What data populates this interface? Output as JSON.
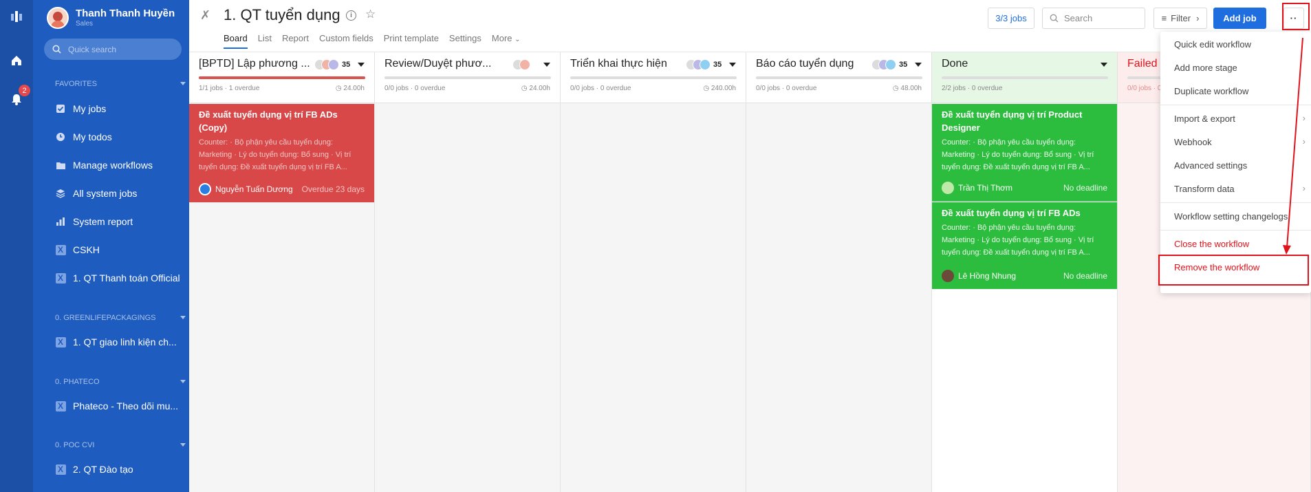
{
  "user": {
    "name": "Thanh Thanh Huyền",
    "role": "Sales"
  },
  "rail": {
    "notification_count": "2"
  },
  "sidebar": {
    "quick_search_placeholder": "Quick search",
    "favorites_title": "FAVORITES",
    "favorites": [
      {
        "label": "My jobs",
        "icon": "checkbox-icon"
      },
      {
        "label": "My todos",
        "icon": "clock-icon"
      },
      {
        "label": "Manage workflows",
        "icon": "folder-icon"
      },
      {
        "label": "All system jobs",
        "icon": "layers-icon"
      },
      {
        "label": "System report",
        "icon": "bar-chart-icon"
      },
      {
        "label": "CSKH",
        "icon": "workflow-icon"
      },
      {
        "label": "1. QT Thanh toán Official",
        "icon": "workflow-icon"
      }
    ],
    "group1_title": "0. GREENLIFEPACKAGINGS",
    "group1_items": [
      {
        "label": "1. QT giao linh kiện ch...",
        "icon": "workflow-icon"
      }
    ],
    "group2_title": "0. PHATECO",
    "group2_items": [
      {
        "label": "Phateco - Theo dõi mu...",
        "icon": "workflow-icon"
      }
    ],
    "group3_title": "0. POC CVI",
    "group3_items": [
      {
        "label": "2. QT Đào tạo",
        "icon": "workflow-icon"
      }
    ]
  },
  "header": {
    "title": "1. QT tuyển dụng",
    "tabs": [
      "Board",
      "List",
      "Report",
      "Custom fields",
      "Print template",
      "Settings",
      "More"
    ],
    "jobs_label": "3/3 jobs",
    "search_placeholder": "Search",
    "filter_label": "Filter",
    "add_job_label": "Add job",
    "more_label": "··"
  },
  "columns": [
    {
      "title": "[BPTD] Lập phương ...",
      "count": "35",
      "meta": "1/1 jobs · 1 overdue",
      "hours": "24.00h",
      "progress": 1.0,
      "bar_color": "#d9534f",
      "head_bg": "#ffffff"
    },
    {
      "title": "Review/Duyệt phươ...",
      "count": "",
      "meta": "0/0 jobs · 0 overdue",
      "hours": "24.00h",
      "progress": 0,
      "bar_color": "#cccccc",
      "head_bg": "#ffffff"
    },
    {
      "title": "Triển khai thực hiện",
      "count": "35",
      "meta": "0/0 jobs · 0 overdue",
      "hours": "240.00h",
      "progress": 0,
      "bar_color": "#cccccc",
      "head_bg": "#ffffff"
    },
    {
      "title": "Báo cáo tuyển dụng",
      "count": "35",
      "meta": "0/0 jobs · 0 overdue",
      "hours": "48.00h",
      "progress": 0,
      "bar_color": "#cccccc",
      "head_bg": "#ffffff"
    },
    {
      "title": "Done",
      "count": "",
      "meta": "2/2 jobs · 0 overdue",
      "hours": "",
      "progress": 1.0,
      "bar_color": "#cccccc",
      "head_bg": "#e6f7e6"
    },
    {
      "title": "Failed",
      "count": "",
      "meta": "0/0 jobs · 0 overdue",
      "hours": "",
      "progress": 0,
      "bar_color": "#cccccc",
      "head_bg": "#fdecec"
    }
  ],
  "cards": {
    "fb_copy": {
      "title": "Đề xuất tuyển dụng vị trí FB ADs (Copy)",
      "desc": "Counter: · Bộ phận yêu cầu tuyển dụng: Marketing · Lý do tuyển dụng: Bổ sung · Vị trí tuyển dụng: Đề xuất tuyển dụng vị trí FB A...",
      "user": "Nguyễn Tuấn Dương",
      "status": "Overdue 23 days",
      "color": "#d94848"
    },
    "product_designer": {
      "title": "Đề xuất tuyển dụng vị trí Product Designer",
      "desc": "Counter: · Bộ phận yêu cầu tuyển dụng: Marketing · Lý do tuyển dụng: Bổ sung · Vị trí tuyển dụng: Đề xuất tuyển dụng vị trí FB A...",
      "user": "Trần Thị Thơm",
      "status": "No deadline",
      "color": "#2dbd3e"
    },
    "fb_ads": {
      "title": "Đề xuất tuyển dụng vị trí FB ADs",
      "desc": "Counter: · Bộ phận yêu cầu tuyển dụng: Marketing · Lý do tuyển dụng: Bổ sung · Vị trí tuyển dụng: Đề xuất tuyển dụng vị trí FB A...",
      "user": "Lê Hồng Nhung",
      "status": "No deadline",
      "color": "#2dbd3e"
    }
  },
  "menu": {
    "items": [
      "Quick edit workflow",
      "Add more stage",
      "Duplicate workflow",
      "Import & export",
      "Webhook",
      "Advanced settings",
      "Transform data",
      "Workflow setting changelogs",
      "Close the workflow",
      "Remove the workflow"
    ]
  }
}
